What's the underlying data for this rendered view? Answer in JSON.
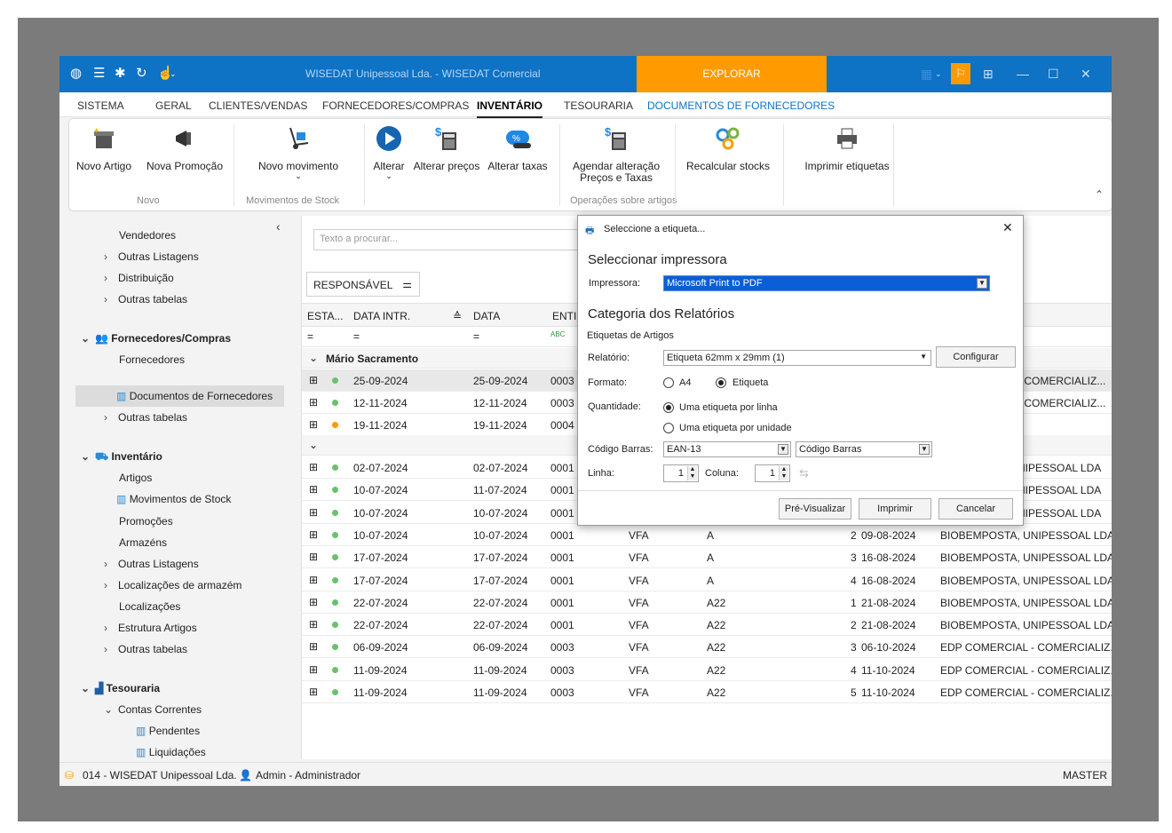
{
  "titlebar": {
    "title": "WISEDAT Unipessoal Lda. - WISEDAT Comercial",
    "explore": "EXPLORAR"
  },
  "menu": {
    "items": [
      "SISTEMA",
      "GERAL",
      "CLIENTES/VENDAS",
      "FORNECEDORES/COMPRAS",
      "INVENTÁRIO",
      "TESOURARIA",
      "DOCUMENTOS DE FORNECEDORES"
    ]
  },
  "ribbon": {
    "novo_artigo": "Novo Artigo",
    "nova_promocao": "Nova Promoção",
    "group_novo": "Novo",
    "novo_movimento": "Novo movimento",
    "group_mov": "Movimentos de Stock",
    "alterar": "Alterar",
    "alterar_precos": "Alterar preços",
    "alterar_taxas": "Alterar taxas",
    "agendar_1": "Agendar alteração",
    "agendar_2": "Preços e Taxas",
    "recalcular": "Recalcular stocks",
    "imprimir": "Imprimir etiquetas",
    "group_ops": "Operações sobre artigos"
  },
  "sidebar": {
    "vendedores": "Vendedores",
    "outras_listagens": "Outras Listagens",
    "distribuicao": "Distribuição",
    "outras_tabelas": "Outras tabelas",
    "fornecedores_compras": "Fornecedores/Compras",
    "fornecedores": "Fornecedores",
    "documentos": "Documentos de Fornecedores",
    "outras_tabelas2": "Outras tabelas",
    "inventario": "Inventário",
    "artigos": "Artigos",
    "movimentos": "Movimentos de Stock",
    "promocoes": "Promoções",
    "armazens": "Armazéns",
    "outras_listagens2": "Outras Listagens",
    "localizacoes_armazem": "Localizações de armazém",
    "localizacoes": "Localizações",
    "estrutura": "Estrutura Artigos",
    "outras_tabelas3": "Outras tabelas",
    "tesouraria": "Tesouraria",
    "contas_correntes": "Contas Correntes",
    "pendentes": "Pendentes",
    "liquidacoes": "Liquidações"
  },
  "main": {
    "search_placeholder": "Texto a procurar...",
    "group_by": "RESPONSÁVEL",
    "columns": [
      "ESTA...",
      "DATA INTR.",
      "DATA",
      "ENTID"
    ],
    "group1": "Mário Sacramento",
    "rows": [
      {
        "d1": "25-09-2024",
        "d2": "25-09-2024",
        "e": "0003",
        "t": "",
        "s": "",
        "n": "",
        "v": "",
        "name": "- COMERCIALIZ...",
        "st": "green"
      },
      {
        "d1": "12-11-2024",
        "d2": "12-11-2024",
        "e": "0003",
        "t": "",
        "s": "",
        "n": "",
        "v": "",
        "name": "- COMERCIALIZ...",
        "st": "green"
      },
      {
        "d1": "19-11-2024",
        "d2": "19-11-2024",
        "e": "0004",
        "t": "",
        "s": "",
        "n": "",
        "v": "",
        "name": "",
        "st": "orange"
      },
      {
        "d1": "02-07-2024",
        "d2": "02-07-2024",
        "e": "0001",
        "t": "",
        "s": "",
        "n": "",
        "v": "",
        "name": "NIPESSOAL LDA",
        "st": "green"
      },
      {
        "d1": "10-07-2024",
        "d2": "11-07-2024",
        "e": "0001",
        "t": "",
        "s": "",
        "n": "",
        "v": "",
        "name": "NIPESSOAL LDA",
        "st": "green"
      },
      {
        "d1": "10-07-2024",
        "d2": "10-07-2024",
        "e": "0001",
        "t": "",
        "s": "",
        "n": "",
        "v": "",
        "name": "NIPESSOAL LDA",
        "st": "green"
      },
      {
        "d1": "10-07-2024",
        "d2": "10-07-2024",
        "e": "0001",
        "t": "VFA",
        "s": "A",
        "n": "2",
        "v": "09-08-2024",
        "name": "BIOBEMPOSTA, UNIPESSOAL LDA",
        "st": "green"
      },
      {
        "d1": "17-07-2024",
        "d2": "17-07-2024",
        "e": "0001",
        "t": "VFA",
        "s": "A",
        "n": "3",
        "v": "16-08-2024",
        "name": "BIOBEMPOSTA, UNIPESSOAL LDA",
        "st": "green"
      },
      {
        "d1": "17-07-2024",
        "d2": "17-07-2024",
        "e": "0001",
        "t": "VFA",
        "s": "A",
        "n": "4",
        "v": "16-08-2024",
        "name": "BIOBEMPOSTA, UNIPESSOAL LDA",
        "st": "green"
      },
      {
        "d1": "22-07-2024",
        "d2": "22-07-2024",
        "e": "0001",
        "t": "VFA",
        "s": "A22",
        "n": "1",
        "v": "21-08-2024",
        "name": "BIOBEMPOSTA, UNIPESSOAL LDA",
        "st": "green"
      },
      {
        "d1": "22-07-2024",
        "d2": "22-07-2024",
        "e": "0001",
        "t": "VFA",
        "s": "A22",
        "n": "2",
        "v": "21-08-2024",
        "name": "BIOBEMPOSTA, UNIPESSOAL LDA",
        "st": "green"
      },
      {
        "d1": "06-09-2024",
        "d2": "06-09-2024",
        "e": "0003",
        "t": "VFA",
        "s": "A22",
        "n": "3",
        "v": "06-10-2024",
        "name": "EDP COMERCIAL - COMERCIALIZ...",
        "st": "green"
      },
      {
        "d1": "11-09-2024",
        "d2": "11-09-2024",
        "e": "0003",
        "t": "VFA",
        "s": "A22",
        "n": "4",
        "v": "11-10-2024",
        "name": "EDP COMERCIAL - COMERCIALIZ...",
        "st": "green"
      },
      {
        "d1": "11-09-2024",
        "d2": "11-09-2024",
        "e": "0003",
        "t": "VFA",
        "s": "A22",
        "n": "5",
        "v": "11-10-2024",
        "name": "EDP COMERCIAL - COMERCIALIZ...",
        "st": "green"
      }
    ]
  },
  "statusbar": {
    "company": "014 - WISEDAT Unipessoal Lda.",
    "user": "Admin - Administrador",
    "db": "MASTER"
  },
  "dialog": {
    "title": "Seleccione a etiqueta...",
    "h_printer": "Seleccionar impressora",
    "printer_label": "Impressora:",
    "printer_value": "Microsoft Print to PDF",
    "h_category": "Categoria dos Relatórios",
    "category_sub": "Etiquetas de Artigos",
    "report_label": "Relatório:",
    "report_value": "Etiqueta 62mm x 29mm (1)",
    "configure": "Configurar",
    "format_label": "Formato:",
    "format_a4": "A4",
    "format_etiqueta": "Etiqueta",
    "qty_label": "Quantidade:",
    "qty_line": "Uma etiqueta por linha",
    "qty_unit": "Uma etiqueta por unidade",
    "barcode_label": "Código Barras:",
    "barcode_type": "EAN-13",
    "barcode_field": "Código Barras",
    "line_label": "Linha:",
    "line_value": "1",
    "col_label": "Coluna:",
    "col_value": "1",
    "preview": "Pré-Visualizar",
    "print": "Imprimir",
    "cancel": "Cancelar"
  },
  "colors": {
    "titlebar": "#0e72c5",
    "accent": "#ff9a00",
    "selection": "#0a5fd6"
  }
}
